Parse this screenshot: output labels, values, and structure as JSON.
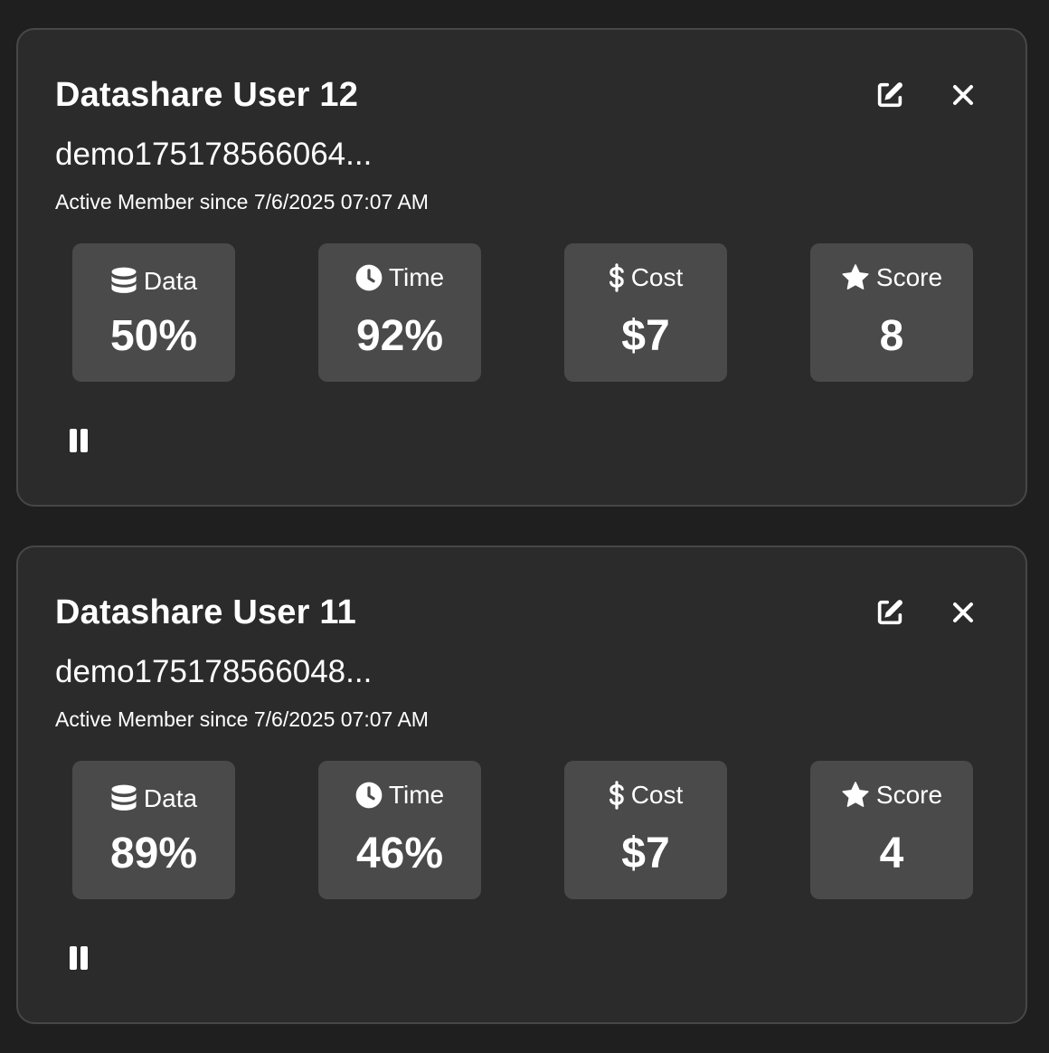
{
  "colors": {
    "page_background": "#1f1f1f",
    "card_background": "#2b2b2b",
    "card_border": "#474747",
    "stat_background": "#4a4a4a",
    "text": "#ffffff"
  },
  "cards": [
    {
      "title": "Datashare User 12",
      "user_id": "demo175178566064...",
      "member_since": "Active Member since 7/6/2025 07:07 AM",
      "stats": {
        "data": {
          "label": "Data",
          "value": "50%",
          "icon": "database-icon"
        },
        "time": {
          "label": "Time",
          "value": "92%",
          "icon": "clock-icon"
        },
        "cost": {
          "label": "Cost",
          "value": "$7",
          "icon": "dollar-icon"
        },
        "score": {
          "label": "Score",
          "value": "8",
          "icon": "star-icon"
        }
      },
      "actions": [
        "edit-icon",
        "close-icon",
        "pause-icon"
      ]
    },
    {
      "title": "Datashare User 11",
      "user_id": "demo175178566048...",
      "member_since": "Active Member since 7/6/2025 07:07 AM",
      "stats": {
        "data": {
          "label": "Data",
          "value": "89%",
          "icon": "database-icon"
        },
        "time": {
          "label": "Time",
          "value": "46%",
          "icon": "clock-icon"
        },
        "cost": {
          "label": "Cost",
          "value": "$7",
          "icon": "dollar-icon"
        },
        "score": {
          "label": "Score",
          "value": "4",
          "icon": "star-icon"
        }
      },
      "actions": [
        "edit-icon",
        "close-icon",
        "pause-icon"
      ]
    }
  ]
}
